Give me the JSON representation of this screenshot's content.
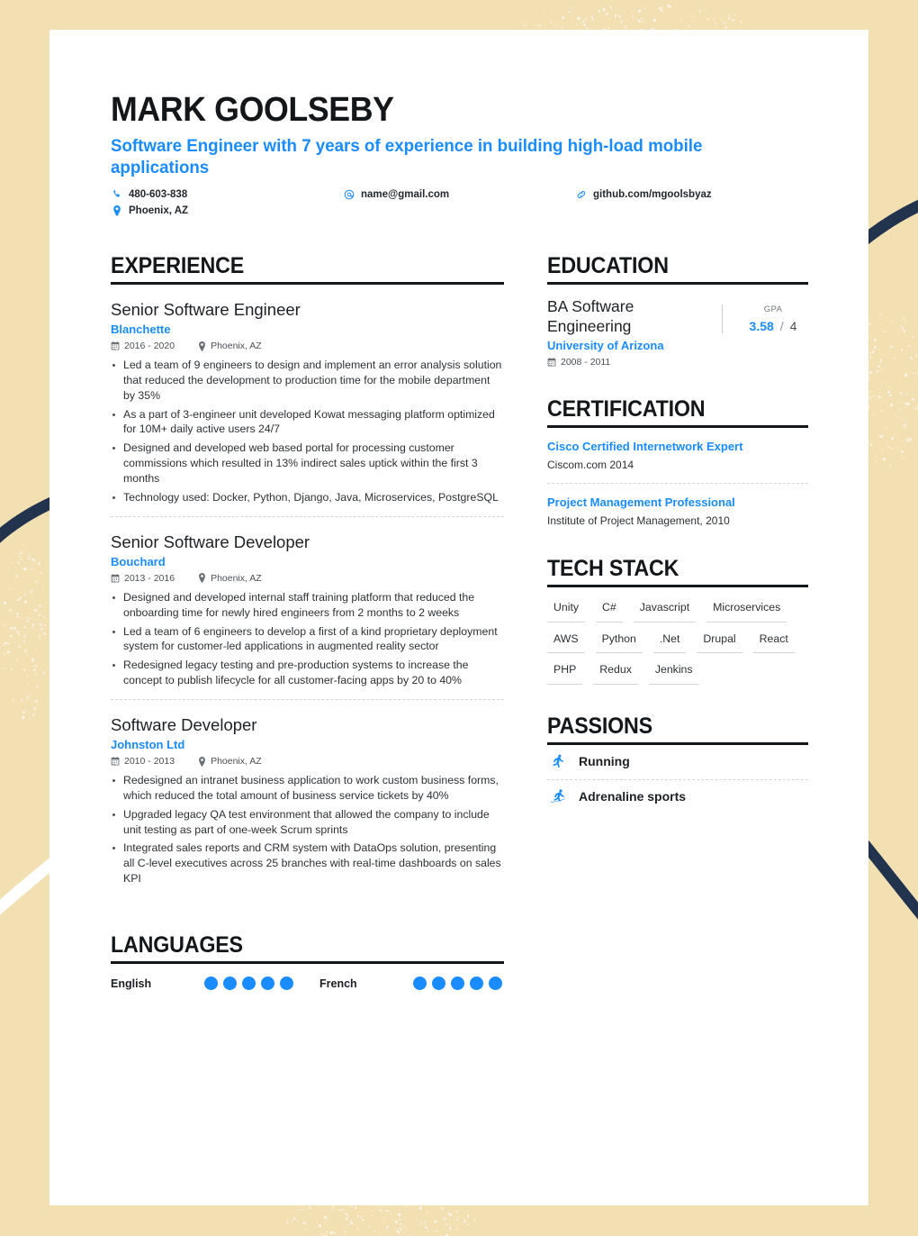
{
  "theme": {
    "accent": "#1a8cff",
    "ink": "#14171a",
    "paper": "#ffffff",
    "backdrop": "#f2dfb2",
    "navy": "#22334d"
  },
  "header": {
    "name": "MARK GOOLSEBY",
    "headline": "Software Engineer with 7 years of experience in building high-load mobile applications",
    "contacts": [
      {
        "icon": "phone-icon",
        "value": "480-603-838"
      },
      {
        "icon": "at-icon",
        "value": "name@gmail.com"
      },
      {
        "icon": "link-icon",
        "value": "github.com/mgoolsbyaz"
      },
      {
        "icon": "location-icon",
        "value": "Phoenix, AZ"
      }
    ]
  },
  "experience": {
    "title": "EXPERIENCE",
    "jobs": [
      {
        "title": "Senior Software Engineer",
        "company": "Blanchette",
        "dates": "2016 - 2020",
        "location": "Phoenix, AZ",
        "bullets": [
          "Led a team of 9 engineers to design and implement an error analysis solution that reduced the development to production time for the mobile department by 35%",
          "As a part of 3-engineer unit developed Kowat messaging platform optimized for 10M+ daily active users 24/7",
          "Designed and developed web based portal for processing customer commissions which resulted in 13% indirect sales uptick within the first 3 months",
          "Technology used: Docker, Python, Django, Java, Microservices, PostgreSQL"
        ]
      },
      {
        "title": "Senior Software Developer",
        "company": "Bouchard",
        "dates": "2013 - 2016",
        "location": "Phoenix, AZ",
        "bullets": [
          "Designed and developed internal staff training platform that reduced the onboarding time for newly hired engineers from 2 months to 2 weeks",
          "Led a team of 6 engineers to develop a first of a kind proprietary deployment system for customer-led applications in augmented reality sector",
          "Redesigned legacy testing and pre-production systems to increase the concept to publish lifecycle for all customer-facing apps by 20 to 40%"
        ]
      },
      {
        "title": "Software Developer",
        "company": "Johnston Ltd",
        "dates": "2010 - 2013",
        "location": "Phoenix, AZ",
        "bullets": [
          "Redesigned an intranet business application to work custom business forms, which reduced the total amount of business service tickets by 40%",
          "Upgraded legacy QA test environment that allowed the company to include unit testing as part of one-week Scrum sprints",
          "Integrated sales reports and CRM system with DataOps solution, presenting all C-level executives across 25 branches with real-time dashboards on sales KPI"
        ]
      }
    ]
  },
  "education": {
    "title": "EDUCATION",
    "entries": [
      {
        "degree": "BA Software Engineering",
        "school": "University of Arizona",
        "dates": "2008 - 2011",
        "gpa_label": "GPA",
        "gpa_score": "3.58",
        "gpa_separator": "/",
        "gpa_max": "4"
      }
    ]
  },
  "certification": {
    "title": "CERTIFICATION",
    "entries": [
      {
        "name": "Cisco Certified Internetwork Expert",
        "org": "Ciscom.com 2014"
      },
      {
        "name": "Project Management Professional",
        "org": "Institute of Project Management, 2010"
      }
    ]
  },
  "tech_stack": {
    "title": "TECH STACK",
    "tags": [
      "Unity",
      "C#",
      "Javascript",
      "Microservices",
      "AWS",
      "Python",
      ".Net",
      "Drupal",
      "React",
      "PHP",
      "Redux",
      "Jenkins"
    ]
  },
  "passions": {
    "title": "PASSIONS",
    "items": [
      {
        "icon": "running-icon",
        "label": "Running"
      },
      {
        "icon": "snowboard-icon",
        "label": "Adrenaline sports"
      }
    ]
  },
  "languages": {
    "title": "LANGUAGES",
    "items": [
      {
        "name": "English",
        "level": 5,
        "max": 5
      },
      {
        "name": "French",
        "level": 5,
        "max": 5
      }
    ]
  }
}
